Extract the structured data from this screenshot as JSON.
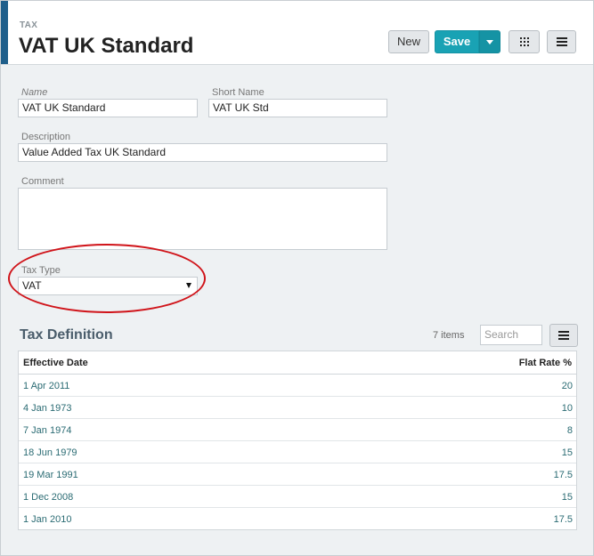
{
  "header": {
    "doc_type": "TAX",
    "title": "VAT UK Standard",
    "new_label": "New",
    "save_label": "Save"
  },
  "form": {
    "name_label": "Name",
    "name_value": "VAT UK Standard",
    "short_name_label": "Short Name",
    "short_name_value": "VAT UK Std",
    "description_label": "Description",
    "description_value": "Value Added Tax UK Standard",
    "comment_label": "Comment",
    "comment_value": "",
    "tax_type_label": "Tax Type",
    "tax_type_value": "VAT"
  },
  "tax_definition": {
    "title": "Tax Definition",
    "items_count": "7 items",
    "search_placeholder": "Search",
    "columns": [
      "Effective Date",
      "Flat Rate %"
    ],
    "rows": [
      {
        "date": "1 Apr 2011",
        "rate": "20"
      },
      {
        "date": "4 Jan 1973",
        "rate": "10"
      },
      {
        "date": "7 Jan 1974",
        "rate": "8"
      },
      {
        "date": "18 Jun 1979",
        "rate": "15"
      },
      {
        "date": "19 Mar 1991",
        "rate": "17.5"
      },
      {
        "date": "1 Dec 2008",
        "rate": "15"
      },
      {
        "date": "1 Jan 2010",
        "rate": "17.5"
      }
    ]
  },
  "colors": {
    "accent": "#1f5f8b",
    "primary_button": "#19a2b4",
    "annotation_circle": "#d0141a",
    "link_text": "#2a6b73"
  },
  "icons": {
    "grid": "grid-icon",
    "menu": "menu-icon",
    "dropdown": "caret-down-icon"
  }
}
